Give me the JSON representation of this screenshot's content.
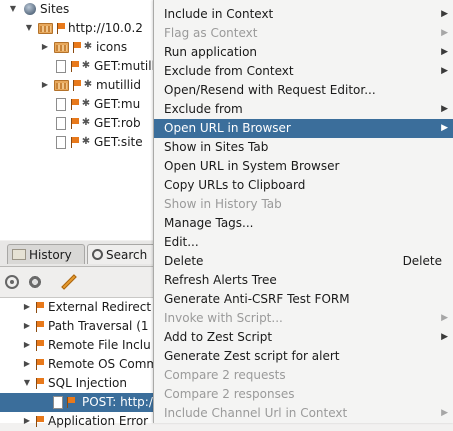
{
  "sites_tree": {
    "root_label": "Sites",
    "site_label": "http://10.0.2",
    "children": [
      {
        "label": "icons",
        "type": "folder"
      },
      {
        "label": "GET:mutill",
        "type": "page"
      },
      {
        "label": "mutillid",
        "type": "folder"
      },
      {
        "label": "GET:mu",
        "type": "page"
      },
      {
        "label": "GET:rob",
        "type": "page"
      },
      {
        "label": "GET:site",
        "type": "page"
      }
    ]
  },
  "tabs": {
    "history_label": "History",
    "search_label": "Search"
  },
  "alerts_tree": {
    "items": [
      {
        "label": "External Redirect"
      },
      {
        "label": "Path Traversal (1"
      },
      {
        "label": "Remote File Inclu"
      },
      {
        "label": "Remote OS Comm"
      },
      {
        "label": "SQL Injection"
      },
      {
        "label": "POST: http://"
      },
      {
        "label": "Application Error"
      }
    ]
  },
  "context_menu": {
    "items": [
      {
        "label": "Include in Context",
        "submenu": true,
        "disabled": false
      },
      {
        "label": "Flag as Context",
        "submenu": true,
        "disabled": true
      },
      {
        "label": "Run application",
        "submenu": true,
        "disabled": false
      },
      {
        "label": "Exclude from Context",
        "submenu": true,
        "disabled": false
      },
      {
        "label": "Open/Resend with Request Editor...",
        "submenu": false,
        "disabled": false
      },
      {
        "label": "Exclude from",
        "submenu": true,
        "disabled": false
      },
      {
        "label": "Open URL in Browser",
        "submenu": true,
        "disabled": false,
        "highlighted": true
      },
      {
        "label": "Show in Sites Tab",
        "submenu": false,
        "disabled": false
      },
      {
        "label": "Open URL in System Browser",
        "submenu": false,
        "disabled": false
      },
      {
        "label": "Copy URLs to Clipboard",
        "submenu": false,
        "disabled": false
      },
      {
        "label": "Show in History Tab",
        "submenu": false,
        "disabled": true
      },
      {
        "label": "Manage Tags...",
        "submenu": false,
        "disabled": false
      },
      {
        "label": "Edit...",
        "submenu": false,
        "disabled": false
      },
      {
        "label": "Delete",
        "submenu": false,
        "disabled": false,
        "accelerator": "Delete"
      },
      {
        "label": "Refresh Alerts Tree",
        "submenu": false,
        "disabled": false
      },
      {
        "label": "Generate Anti-CSRF Test FORM",
        "submenu": false,
        "disabled": false
      },
      {
        "label": "Invoke with Script...",
        "submenu": true,
        "disabled": true
      },
      {
        "label": "Add to Zest Script",
        "submenu": true,
        "disabled": false
      },
      {
        "label": "Generate Zest script for alert",
        "submenu": false,
        "disabled": false
      },
      {
        "label": "Compare 2 requests",
        "submenu": false,
        "disabled": true
      },
      {
        "label": "Compare 2 responses",
        "submenu": false,
        "disabled": true
      },
      {
        "label": "Include Channel Url in Context",
        "submenu": true,
        "disabled": true
      }
    ]
  },
  "colors": {
    "selection": "#3b6e9b",
    "flag": "#e8791b",
    "disabled_text": "#9a9a9a"
  }
}
